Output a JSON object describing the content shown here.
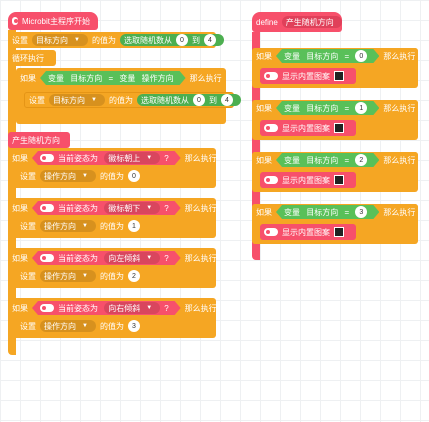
{
  "left": {
    "start_label": "Microbit主程序开始",
    "set_label": "设置",
    "target_dir": "目标方向",
    "value_to": "的值为",
    "random_label": "选取随机数从",
    "to_label": "到",
    "random_from": "0",
    "random_to": "4",
    "loop_label": "循环执行",
    "if_label": "如果",
    "then_label": "那么执行",
    "variable_label": "变量",
    "op_dir": "操作方向",
    "equals": "=",
    "proc_call": "产生随机方向",
    "conditions": [
      {
        "gesture": "当前姿态为",
        "dir": "徽标朝上",
        "value": "0"
      },
      {
        "gesture": "当前姿态为",
        "dir": "徽标朝下",
        "value": "1"
      },
      {
        "gesture": "当前姿态为",
        "dir": "向左倾斜",
        "value": "2"
      },
      {
        "gesture": "当前姿态为",
        "dir": "向右倾斜",
        "value": "3"
      }
    ],
    "question": "?"
  },
  "right": {
    "define_label": "define",
    "proc_name": "产生随机方向",
    "if_label": "如果",
    "then_label": "那么执行",
    "variable_label": "变量",
    "target_dir": "目标方向",
    "equals": "=",
    "show_label": "显示内置图案",
    "cases": [
      {
        "value": "0"
      },
      {
        "value": "1"
      },
      {
        "value": "2"
      },
      {
        "value": "3"
      }
    ]
  },
  "colors": {
    "orange": "#f5a623",
    "pink": "#f7506b",
    "green": "#59c059",
    "grid": "#eef0f2"
  }
}
